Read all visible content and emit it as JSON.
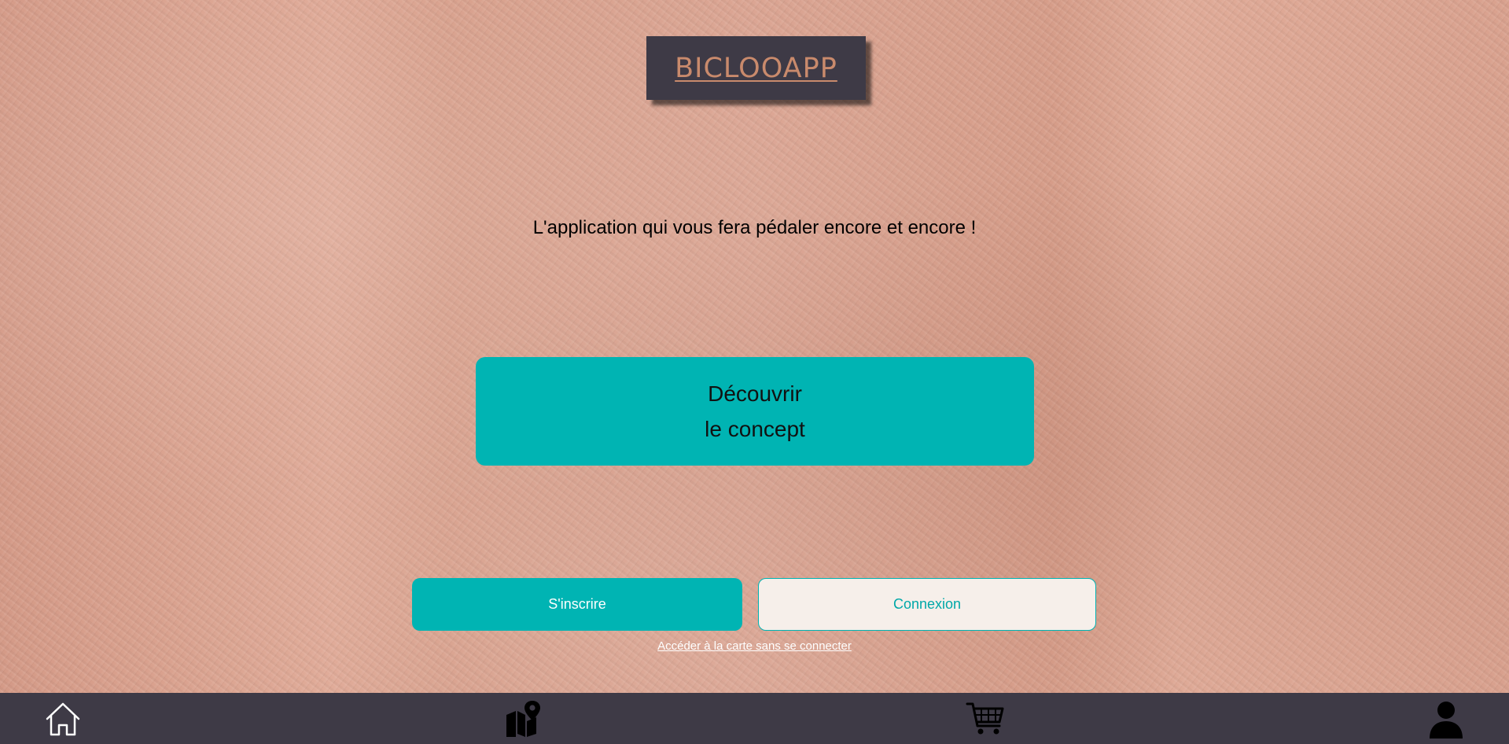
{
  "logo": {
    "text": "BICLOOAPP"
  },
  "hero": {
    "tagline": "L'application qui vous fera pédaler encore et encore !"
  },
  "discover_button": {
    "line1": "Découvrir",
    "line2": "le concept"
  },
  "auth": {
    "signup_label": "S'inscrire",
    "login_label": "Connexion",
    "map_link_label": "Accéder à la carte sans se connecter"
  },
  "nav": {
    "items": [
      {
        "icon": "home-icon"
      },
      {
        "icon": "map-pin-icon"
      },
      {
        "icon": "cart-icon"
      },
      {
        "icon": "user-icon"
      }
    ]
  },
  "colors": {
    "accent": "#00b4b3",
    "nav_background": "#3e3a46",
    "logo_text": "#c98a6c",
    "wall_background": "#d9a08d"
  }
}
